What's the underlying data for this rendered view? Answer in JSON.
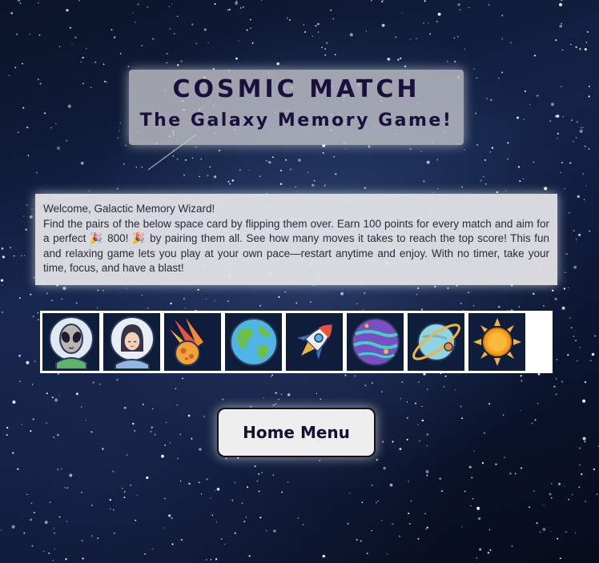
{
  "header": {
    "title": "COSMIC MATCH",
    "subtitle": "The Galaxy Memory Game!"
  },
  "intro": {
    "greeting": "Welcome, Galactic Memory Wizard!",
    "body": "Find the pairs of the below space card by flipping them over. Earn 100 points for every match and aim for a perfect 🎉 800! 🎉 by pairing them all. See how many moves it takes to reach the top score! This fun and relaxing game lets you play at your own pace—restart anytime and enjoy. With no timer, take your time, focus, and have a blast!"
  },
  "cards": [
    {
      "icon": "alien-icon"
    },
    {
      "icon": "astronaut-icon"
    },
    {
      "icon": "meteor-icon"
    },
    {
      "icon": "earth-icon"
    },
    {
      "icon": "rocket-icon"
    },
    {
      "icon": "purple-planet-icon"
    },
    {
      "icon": "ringed-planet-icon"
    },
    {
      "icon": "sun-icon"
    }
  ],
  "home_button": {
    "label": "Home Menu"
  },
  "colors": {
    "title_text": "#1a0f3d",
    "card_bg": "#0f1d3d",
    "button_bg": "#eeeeee"
  }
}
